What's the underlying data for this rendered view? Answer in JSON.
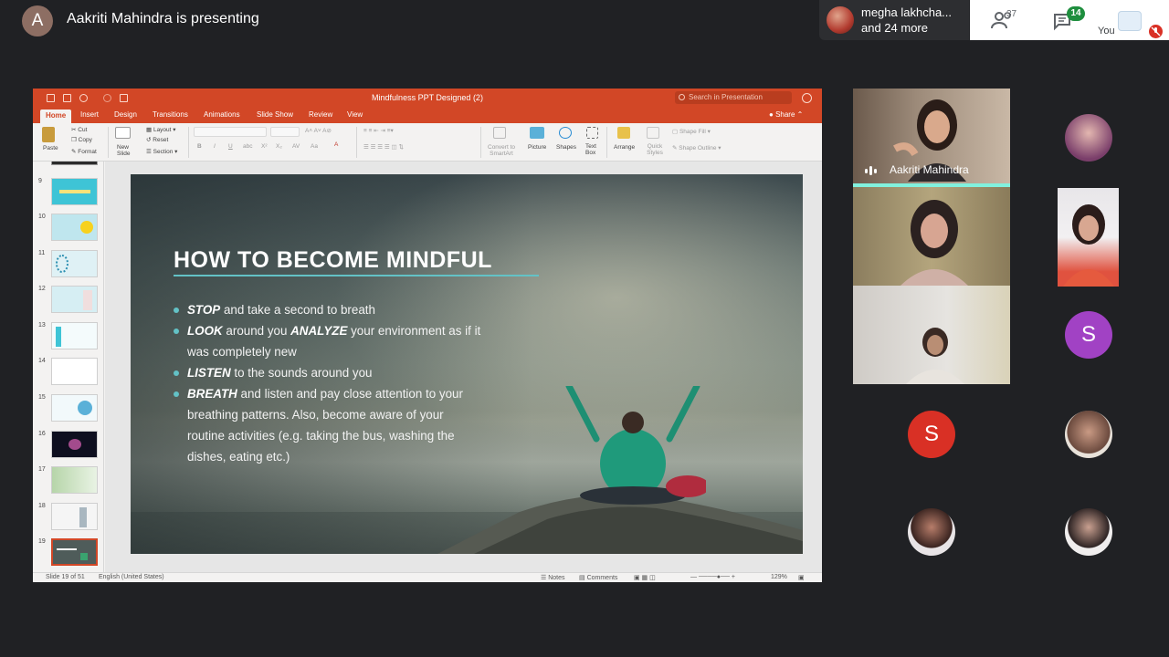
{
  "header": {
    "presenter_initial": "A",
    "presenting_text": "Aakriti Mahindra is presenting"
  },
  "participants_summary": {
    "name": "megha lakhcha...",
    "more": "and 24 more"
  },
  "controls": {
    "people_count": "37",
    "chat_badge": "14",
    "you_label": "You"
  },
  "ppt": {
    "document_title": "Mindfulness PPT Designed (2)",
    "search_placeholder": "Search in Presentation",
    "tabs": [
      "Home",
      "Insert",
      "Design",
      "Transitions",
      "Animations",
      "Slide Show",
      "Review",
      "View"
    ],
    "active_tab": "Home",
    "share_label": "Share",
    "ribbon": {
      "paste": "Paste",
      "cut": "Cut",
      "copy": "Copy",
      "format": "Format",
      "new_slide": "New Slide",
      "layout": "Layout",
      "reset": "Reset",
      "section": "Section",
      "convert_smartart": "Convert to SmartArt",
      "picture": "Picture",
      "shapes": "Shapes",
      "text_box": "Text Box",
      "arrange": "Arrange",
      "quick_styles": "Quick Styles",
      "shape_fill": "Shape Fill",
      "shape_outline": "Shape Outline"
    },
    "thumbnails": [
      {
        "num": "9"
      },
      {
        "num": "10"
      },
      {
        "num": "11"
      },
      {
        "num": "12"
      },
      {
        "num": "13"
      },
      {
        "num": "14"
      },
      {
        "num": "15"
      },
      {
        "num": "16"
      },
      {
        "num": "17"
      },
      {
        "num": "18"
      },
      {
        "num": "19"
      }
    ],
    "slide": {
      "title": "HOW TO BECOME MINDFUL",
      "bullets": [
        {
          "bold": "STOP",
          "text": " and take a second to breath"
        },
        {
          "bold": "LOOK",
          "text": " around you ",
          "bold2": "ANALYZE",
          "text2": " your environment as if it"
        },
        {
          "continuation": "was completely new"
        },
        {
          "bold": "LISTEN",
          "text": " to the sounds around you"
        },
        {
          "bold": "BREATH",
          "text": " and listen and pay close attention to your"
        },
        {
          "continuation": "breathing patterns. Also, become aware of your"
        },
        {
          "continuation": "routine activities (e.g. taking the bus, washing the"
        },
        {
          "continuation": "dishes, eating etc.)"
        }
      ]
    },
    "status": {
      "slide_count": "Slide 19 of 51",
      "language": "English (United States)",
      "notes": "Notes",
      "comments": "Comments",
      "zoom": "129%"
    }
  },
  "tiles": {
    "main_speaker": "Aakriti Mahindra",
    "letter_avatar_1": "S",
    "letter_avatar_2": "S"
  },
  "colors": {
    "ppt_accent": "#d24726",
    "slide_accent": "#63c2c6",
    "meet_bg": "#202124",
    "chat_badge": "#1e8e3e",
    "avatar_purple": "#a142c4",
    "avatar_red": "#d93025"
  }
}
